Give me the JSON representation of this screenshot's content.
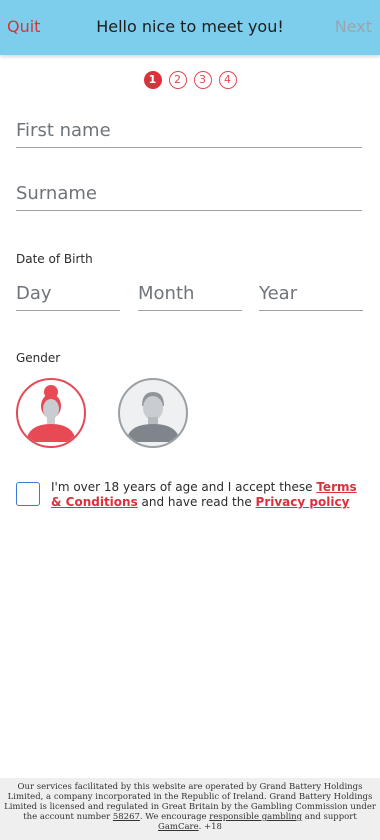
{
  "header": {
    "quit_label": "Quit",
    "title": "Hello nice to meet you!",
    "next_label": "Next"
  },
  "steps": [
    "1",
    "2",
    "3",
    "4"
  ],
  "form": {
    "first_name_placeholder": "First name",
    "surname_placeholder": "Surname",
    "dob_label": "Date of Birth",
    "day_placeholder": "Day",
    "month_placeholder": "Month",
    "year_placeholder": "Year",
    "gender_label": "Gender"
  },
  "terms": {
    "text_before": "I'm over 18 years of age and I accept these ",
    "terms_link": "Terms & Conditions",
    "text_middle": " and have read the ",
    "privacy_link": "Privacy policy"
  },
  "footer": {
    "text1": "Our services facilitated by this website are operated by Grand Battery Holdings Limited, a company incorporated in the Republic of Ireland. Grand Battery Holdings Limited is licensed and regulated in Great Britain by the Gambling Commission under the account number ",
    "account_number": "58267",
    "text2": ". We encourage ",
    "responsible_link": "responsible gambling",
    "text3": " and support ",
    "gamcare_link": "GamCare",
    "text4": ". +18"
  },
  "colors": {
    "header_bg": "#7dcdec",
    "accent_red": "#d9323c",
    "checkbox_blue": "#3a7bd5"
  }
}
